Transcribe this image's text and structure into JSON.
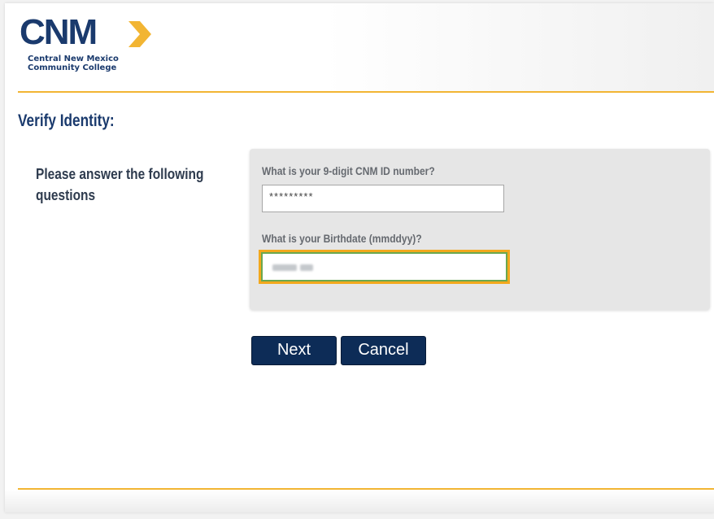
{
  "header": {
    "logo_text": "CNM",
    "logo_subtitle_line1": "Central New Mexico",
    "logo_subtitle_line2": "Community College"
  },
  "page_title": "Verify Identity:",
  "instructions": "Please answer the following questions",
  "form": {
    "id_question": "What is your 9-digit CNM ID number?",
    "id_value": "*********",
    "birthdate_question": "What is your Birthdate (mmddyy)?"
  },
  "buttons": {
    "next_label": "Next",
    "cancel_label": "Cancel"
  },
  "colors": {
    "brand_navy": "#1a3a6d",
    "gold_accent": "#f2b533",
    "button_navy": "#0d2c57",
    "focus_orange": "#f2a81d",
    "focus_green": "#6aa84f"
  }
}
